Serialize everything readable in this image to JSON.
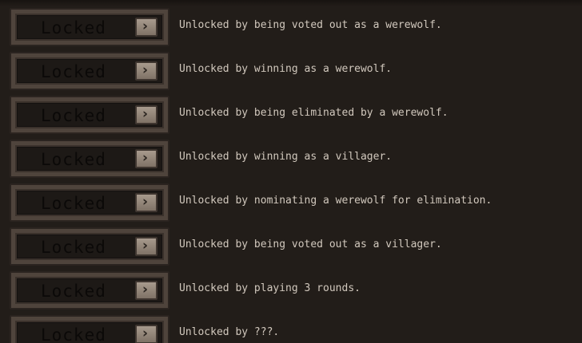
{
  "achievements": [
    {
      "status": "Locked",
      "arrow": "›",
      "description": "Unlocked by being voted out as a werewolf."
    },
    {
      "status": "Locked",
      "arrow": "›",
      "description": "Unlocked by winning as a werewolf."
    },
    {
      "status": "Locked",
      "arrow": "›",
      "description": "Unlocked by being eliminated by a werewolf."
    },
    {
      "status": "Locked",
      "arrow": "›",
      "description": "Unlocked by winning as a villager."
    },
    {
      "status": "Locked",
      "arrow": "›",
      "description": "Unlocked by nominating a werewolf for elimination."
    },
    {
      "status": "Locked",
      "arrow": "›",
      "description": "Unlocked by being voted out as a villager."
    },
    {
      "status": "Locked",
      "arrow": "›",
      "description": "Unlocked by playing 3 rounds."
    },
    {
      "status": "Locked",
      "arrow": "›",
      "description": "Unlocked by ???."
    }
  ],
  "colors": {
    "background": "#221d19",
    "plate": "#4f443c",
    "text": "#d1c8bd",
    "locked_text": "#0b0908"
  },
  "icons": {
    "arrow": "chevron-right-icon"
  }
}
